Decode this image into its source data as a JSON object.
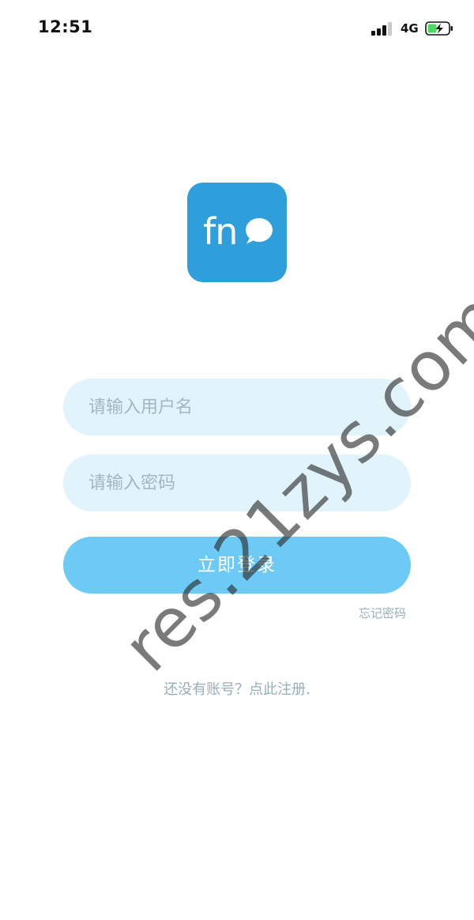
{
  "status_bar": {
    "time": "12:51",
    "network": "4G",
    "icons": [
      "signal-icon",
      "battery-charging-icon"
    ],
    "battery_color": "#4cd964"
  },
  "logo": {
    "text": "fn",
    "icon": "chat-bubble-icon",
    "background_color": "#2f9fdb"
  },
  "form": {
    "username": {
      "placeholder": "请输入用户名",
      "value": ""
    },
    "password": {
      "placeholder": "请输入密码",
      "value": ""
    },
    "login_label": "立即登录",
    "forgot_label": "忘记密码"
  },
  "footer": {
    "register_label": "还没有账号？点此注册."
  },
  "watermark": {
    "text": "res.21zys.com"
  },
  "colors": {
    "input_background": "#e1f3fb",
    "button_background": "#6ccaf5",
    "link_text": "#98aebc"
  }
}
